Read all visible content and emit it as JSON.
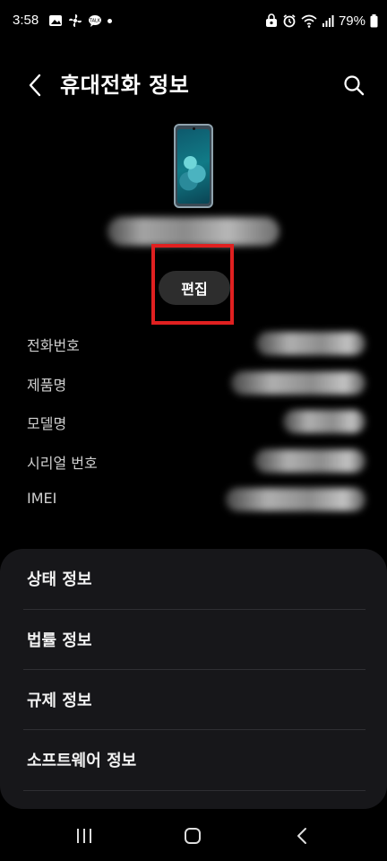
{
  "status_bar": {
    "time": "3:58",
    "battery_text": "79%",
    "left_icons": [
      "gallery-icon",
      "pinwheel-icon",
      "chat-bubble-icon",
      "notification-dot"
    ],
    "right_icons": [
      "alarm-icon",
      "wifi-icon",
      "signal-icon",
      "battery-icon"
    ]
  },
  "header": {
    "title": "휴대전화 정보"
  },
  "device": {
    "edit_label": "편집"
  },
  "info": {
    "rows": [
      {
        "label": "전화번호"
      },
      {
        "label": "제품명"
      },
      {
        "label": "모델명"
      },
      {
        "label": "시리얼 번호"
      },
      {
        "label": "IMEI"
      }
    ]
  },
  "menu": {
    "items": [
      {
        "label": "상태 정보"
      },
      {
        "label": "법률 정보"
      },
      {
        "label": "규제 정보"
      },
      {
        "label": "소프트웨어 정보"
      }
    ]
  },
  "colors": {
    "background": "#000000",
    "card": "#17171a",
    "edit_button": "#2d2d2d",
    "highlight": "#e02020"
  }
}
